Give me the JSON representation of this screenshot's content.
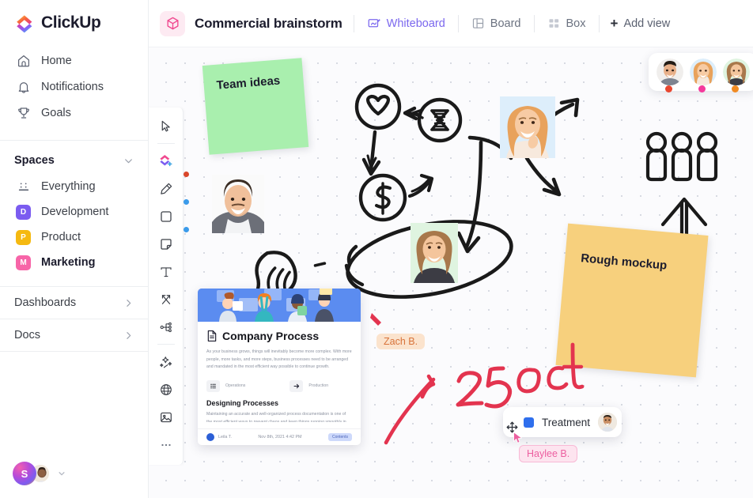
{
  "brand": {
    "name": "ClickUp"
  },
  "sidebar": {
    "nav": [
      {
        "label": "Home",
        "icon": "home-icon"
      },
      {
        "label": "Notifications",
        "icon": "bell-icon"
      },
      {
        "label": "Goals",
        "icon": "trophy-icon"
      }
    ],
    "spaces_header": "Spaces",
    "spaces": [
      {
        "label": "Everything",
        "icon": "grid-dots-icon",
        "badge": "",
        "color": ""
      },
      {
        "label": "Development",
        "badge": "D",
        "color": "#7b5cf0",
        "active": false
      },
      {
        "label": "Product",
        "badge": "P",
        "color": "#f5b911",
        "active": false
      },
      {
        "label": "Marketing",
        "badge": "M",
        "color": "#f765a8",
        "active": true
      }
    ],
    "links": [
      {
        "label": "Dashboards",
        "icon": "chevron-right-icon"
      },
      {
        "label": "Docs",
        "icon": "chevron-right-icon"
      }
    ],
    "footer": {
      "workspace_initial": "S",
      "caret": "▾"
    }
  },
  "topbar": {
    "doc_icon": "cube-icon",
    "title": "Commercial brainstorm",
    "views": [
      {
        "label": "Whiteboard",
        "icon": "whiteboard-icon",
        "active": true
      },
      {
        "label": "Board",
        "icon": "board-icon",
        "active": false
      },
      {
        "label": "Box",
        "icon": "box-icon",
        "active": false
      }
    ],
    "add_view": {
      "label": "Add view",
      "plus": "+"
    }
  },
  "toolbar": {
    "tools": [
      {
        "name": "select-tool",
        "icon": "cursor-icon"
      },
      {
        "name": "shapes-tool",
        "icon": "shapes-color-icon"
      },
      {
        "name": "pen-tool",
        "icon": "pen-icon",
        "dot": "#d9472b"
      },
      {
        "name": "rectangle-tool",
        "icon": "square-icon",
        "dot": "#3b9bea"
      },
      {
        "name": "sticky-note-tool",
        "icon": "sticky-note-icon",
        "dot": "#3b9bea"
      },
      {
        "name": "text-tool",
        "icon": "text-t-icon"
      },
      {
        "name": "connector-tool",
        "icon": "connector-icon"
      },
      {
        "name": "mindmap-tool",
        "icon": "mindmap-icon"
      },
      {
        "name": "ai-tool",
        "icon": "sparkle-wand-icon"
      },
      {
        "name": "embed-tool",
        "icon": "globe-icon"
      },
      {
        "name": "image-tool",
        "icon": "image-icon"
      },
      {
        "name": "more-tool",
        "icon": "ellipsis-icon"
      }
    ]
  },
  "canvas": {
    "sticky_notes": [
      {
        "text": "Team ideas",
        "color": "#a9efae"
      },
      {
        "text": "Rough mockup",
        "color": "#f7d07d"
      }
    ],
    "shapes": [
      {
        "name": "heart-circle",
        "icon": "heart-icon"
      },
      {
        "name": "hourglass-circle",
        "icon": "hourglass-icon"
      },
      {
        "name": "dollar-circle",
        "icon": "dollar-icon"
      },
      {
        "name": "lightbulb-sketch",
        "icon": "lightbulb-icon"
      },
      {
        "name": "people-group-sketch",
        "icon": "three-people-icon"
      },
      {
        "name": "up-arrow-sketch",
        "icon": "up-arrow-icon"
      }
    ],
    "handwriting": {
      "text": "25 oct",
      "color": "#e3344f"
    },
    "process_card": {
      "title": "Company Process",
      "body": "As your business grows, things will inevitably become more complex. With more people, more tasks, and more steps, business processes need to be arranged and mandated in the most efficient way possible to continue growth.",
      "chips": [
        {
          "label": "Operations",
          "icon": "list-icon"
        },
        {
          "label": "Production",
          "icon": "arrow-right-icon"
        }
      ],
      "subtitle": "Designing Processes",
      "body2": "Maintaining an accurate and well-organized process documentation is one of the most efficient ways to prevent chaos and keep things running smoothly in the workplace.",
      "author": "Leila T.",
      "timestamp": "Nov 8th, 2021 4:42 PM",
      "badge": "Contents"
    },
    "treatment_card": {
      "label": "Treatment",
      "icon": "blue-square-icon"
    },
    "cursors": [
      {
        "name": "Zach B.",
        "color": "#d8733a"
      },
      {
        "name": "Haylee B.",
        "color": "#ec5fa0"
      }
    ],
    "collaborators": [
      {
        "status_color": "#e8462f"
      },
      {
        "status_color": "#f4399c"
      },
      {
        "status_color": "#f08a22"
      }
    ]
  }
}
